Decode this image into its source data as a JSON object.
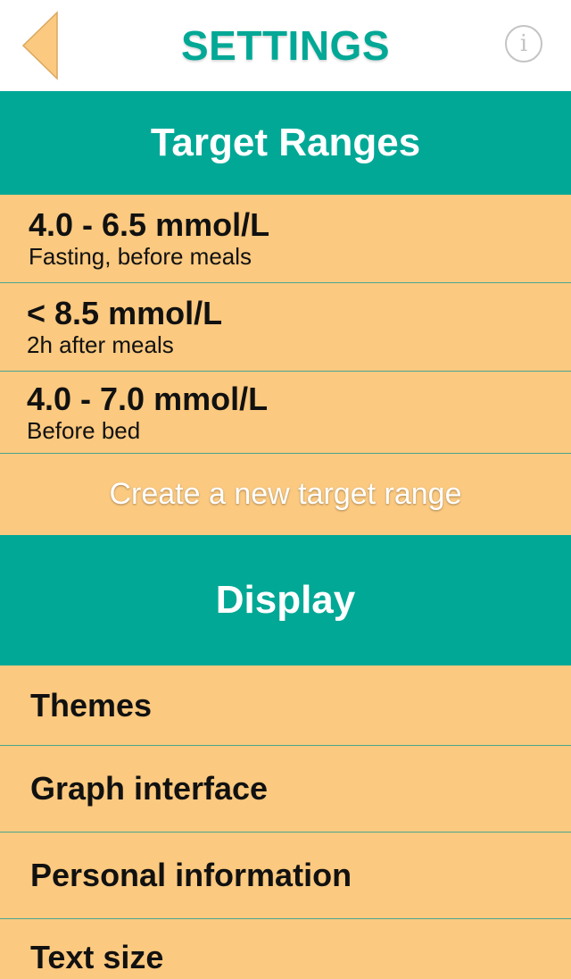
{
  "header": {
    "title": "SETTINGS",
    "back_icon": "back-arrow-icon",
    "info_icon": "info-icon",
    "info_glyph": "i",
    "title_color": "#02A896"
  },
  "target_ranges": {
    "heading": "Target Ranges",
    "items": [
      {
        "value": "4.0 - 6.5 mmol/L",
        "description": "Fasting, before meals"
      },
      {
        "value": "< 8.5 mmol/L",
        "description": "2h after meals"
      },
      {
        "value": "4.0 - 7.0 mmol/L",
        "description": "Before bed"
      }
    ],
    "create_label": "Create a new target range"
  },
  "display": {
    "heading": "Display",
    "items": [
      {
        "label": "Themes"
      },
      {
        "label": "Graph interface"
      },
      {
        "label": "Personal information"
      },
      {
        "label": "Text size"
      }
    ]
  },
  "colors": {
    "accent": "#02A896",
    "row_background": "#FBC97F",
    "back_arrow": "#FBC97F"
  }
}
